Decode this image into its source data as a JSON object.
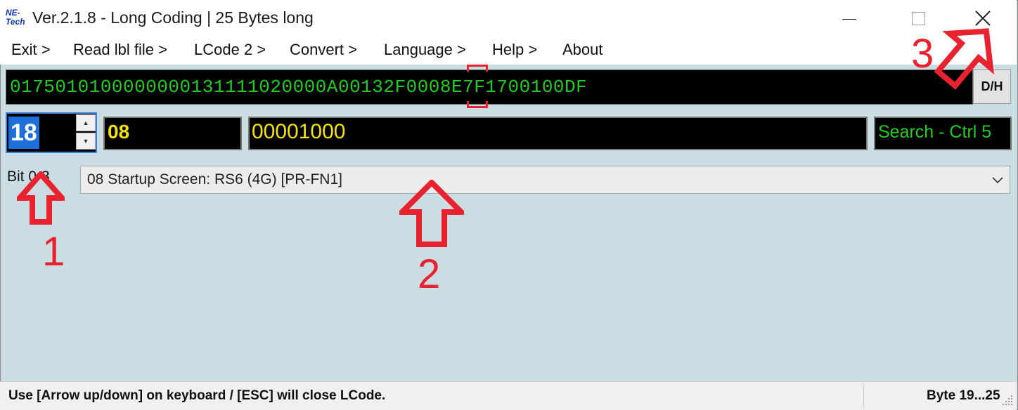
{
  "window": {
    "logo_text_1": "NE-",
    "logo_text_2": "Tech",
    "title": "Ver.2.1.8 - Long Coding | 25 Bytes long"
  },
  "menu": {
    "items": [
      "Exit >",
      "Read lbl file >",
      "LCode 2 >",
      "Convert >",
      "Language >",
      "Help >",
      "About"
    ]
  },
  "coding": {
    "hex": "0175010100000000131111020000A00132F0008E7F1700100DF",
    "dh_button": "D/H"
  },
  "byte_row": {
    "byte_index": "18",
    "hex_value": "08",
    "binary_value": "00001000",
    "search": "Search - Ctrl 5"
  },
  "option_row": {
    "bit_label": "Bit 0-3",
    "selected_option": "08 Startup Screen: RS6 (4G) [PR-FN1]"
  },
  "statusbar": {
    "hint": "Use [Arrow up/down] on keyboard / [ESC] will close LCode.",
    "byte_range": "Byte 19...25"
  },
  "annotations": {
    "labels": [
      "1",
      "2",
      "3"
    ],
    "color": "#e8222e"
  },
  "colors": {
    "hex_text": "#22cc22",
    "byte_text": "#f5e20d",
    "selection": "#1e6fd9",
    "background": "#c9dde2"
  }
}
